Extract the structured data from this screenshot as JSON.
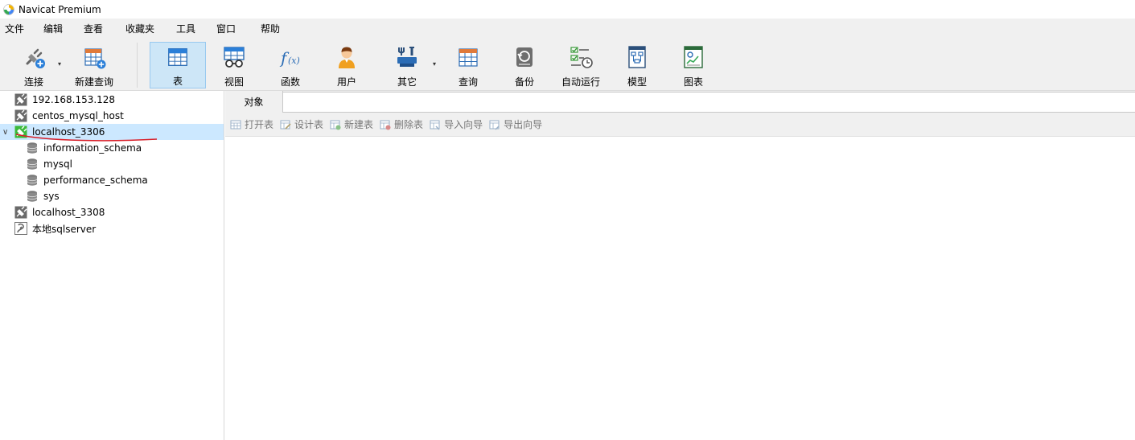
{
  "window": {
    "title": "Navicat Premium"
  },
  "menu": {
    "items": [
      "文件",
      "编辑",
      "查看",
      "收藏夹",
      "工具",
      "窗口",
      "帮助"
    ]
  },
  "toolbar": {
    "connect": "连接",
    "new_query": "新建查询",
    "table": "表",
    "view": "视图",
    "function": "函数",
    "user": "用户",
    "other": "其它",
    "query": "查询",
    "backup": "备份",
    "auto_run": "自动运行",
    "model": "模型",
    "chart": "图表"
  },
  "tree": {
    "items": [
      {
        "label": "192.168.153.128"
      },
      {
        "label": "centos_mysql_host"
      },
      {
        "label": "localhost_3306"
      },
      {
        "label": "information_schema"
      },
      {
        "label": "mysql"
      },
      {
        "label": "performance_schema"
      },
      {
        "label": "sys"
      },
      {
        "label": "localhost_3308"
      },
      {
        "label": "本地sqlserver"
      }
    ]
  },
  "tabs": {
    "objects": "对象"
  },
  "object_toolbar": {
    "open_table": "打开表",
    "design_table": "设计表",
    "new_table": "新建表",
    "delete_table": "删除表",
    "import_wizard": "导入向导",
    "export_wizard": "导出向导"
  },
  "colors": {
    "accent": "#2b7fd8",
    "selection": "#cce8ff",
    "annotation": "#d9202a",
    "mysql_connected": "#3cba3c"
  }
}
